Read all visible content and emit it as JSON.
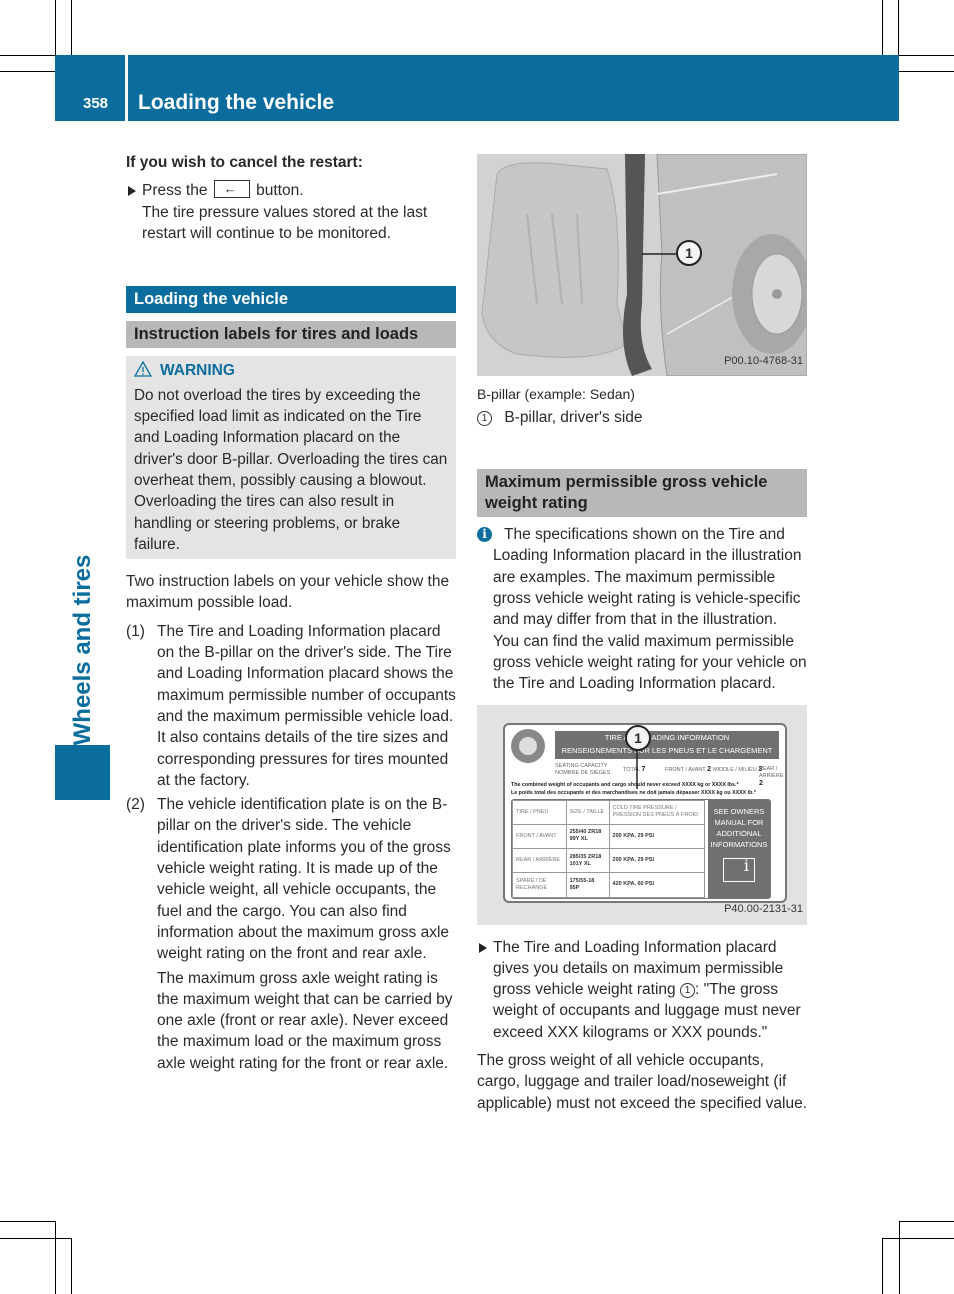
{
  "header": {
    "page_number": "358",
    "title": "Loading the vehicle"
  },
  "side_tab": {
    "label": "Wheels and tires"
  },
  "left": {
    "cancel_heading": "If you wish to cancel the restart:",
    "press_prefix": "Press the",
    "press_key_icon": "back-arrow-icon",
    "press_suffix": "button.",
    "press_result": "The tire pressure values stored at the last restart will continue to be monitored.",
    "section_title": "Loading the vehicle",
    "subsection_title": "Instruction labels for tires and loads",
    "warning": {
      "label": "WARNING",
      "text": "Do not overload the tires by exceeding the specified load limit as indicated on the Tire and Loading Information placard on the driver's door B-pillar. Overloading the tires can overheat them, possibly causing a blowout. Overloading the tires can also result in handling or steering problems, or brake failure."
    },
    "intro": "Two instruction labels on your vehicle show the maximum possible load.",
    "items": [
      {
        "num": "(1)",
        "text": "The Tire and Loading Information placard on the B-pillar on the driver's side. The Tire and Loading Information placard shows the maximum permissible number of occupants and the maximum permissible vehicle load. It also contains details of the tire sizes and corresponding pressures for tires mounted at the factory."
      },
      {
        "num": "(2)",
        "text": "The vehicle identification plate is on the B-pillar on the driver's side. The vehicle identification plate informs you of the gross vehicle weight rating. It is made up of the vehicle weight, all vehicle occupants, the fuel and the cargo. You can also find information about the maximum gross axle weight rating on the front and rear axle.",
        "extra": "The maximum gross axle weight rating is the maximum weight that can be carried by one axle (front or rear axle). Never exceed the maximum load or the maximum gross axle weight rating for the front or rear axle."
      }
    ]
  },
  "right": {
    "figure1": {
      "callout": "1",
      "id": "P00.10-4768-31",
      "caption": "B-pillar (example: Sedan)",
      "legend_num": "1",
      "legend_text": "B-pillar, driver's side"
    },
    "section_title": "Maximum permissible gross vehicle weight rating",
    "info_text": "The specifications shown on the Tire and Loading Information placard in the illustration are examples. The maximum permissible gross vehicle weight rating is vehicle-specific and may differ from that in the illustration. You can find the valid maximum permissible gross vehicle weight rating for your vehicle on the Tire and Loading Information placard.",
    "figure2": {
      "id": "P40.00-2131-31",
      "callout": "1",
      "placard": {
        "title_en": "TIRE AND LOADING INFORMATION",
        "title_fr": "RENSEIGNEMENTS SUR LES PNEUS ET LE CHARGEMENT",
        "seating_label": [
          "SEATING CAPACITY",
          "NOMBRE DE SIÈGES"
        ],
        "seating": [
          {
            "label": "TOTAL",
            "value": "7"
          },
          {
            "label": "FRONT / AVANT",
            "value": "2"
          },
          {
            "label": "MIDDLE / MILIEU",
            "value": "3"
          },
          {
            "label": "REAR / ARRIÈRE",
            "value": "2"
          }
        ],
        "combined_en": "The combined weight of occupants and cargo should never exceed XXXX kg or XXXX lbs.*",
        "combined_fr": "Le poids total des occupants et des marchandises ne doit jamais dépasser XXXX kg ou XXXX lb.*",
        "table_headers": [
          "TIRE / PNEU",
          "SIZE / TAILLE",
          "COLD TIRE PRESSURE / PRESSION DES PNEUS À FROID"
        ],
        "rows": [
          {
            "tire": "FRONT / AVANT",
            "size": "255/40 ZR18 99Y XL",
            "pressure": "200 KPA, 29 PSI"
          },
          {
            "tire": "REAR / ARRIÈRE",
            "size": "285/35 ZR18 101Y XL",
            "pressure": "200 KPA, 29 PSI"
          },
          {
            "tire": "SPARE / DE RECHANGE",
            "size": "175/55-18 95P",
            "pressure": "420 KPA, 60 PSI"
          }
        ],
        "owner_note": "SEE OWNERS MANUAL FOR ADDITIONAL INFORMATIONS"
      }
    },
    "bullet_text_a": "The Tire and Loading Information placard gives you details on maximum permissible gross vehicle weight rating",
    "bullet_callout": "1",
    "bullet_text_b": ": \"The gross weight of occupants and luggage must never exceed XXX kilograms or XXX pounds.\"",
    "closing": "The gross weight of all vehicle occupants, cargo, luggage and trailer load/noseweight (if applicable) must not exceed the specified value."
  },
  "colors": {
    "brand_blue": "#0a6d9e",
    "subheading_gray": "#b8b8b8",
    "warning_bg": "#e4e4e4"
  }
}
